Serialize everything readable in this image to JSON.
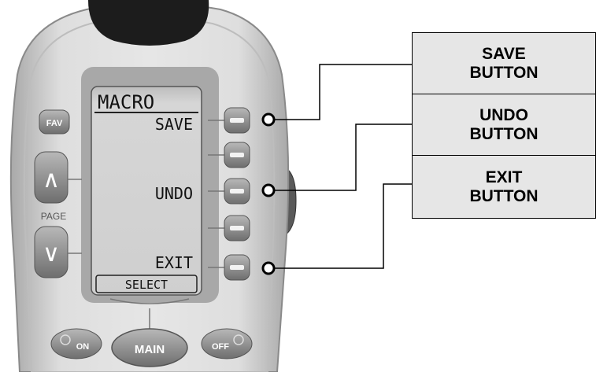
{
  "remote": {
    "screen": {
      "title": "MACRO",
      "soft_labels": [
        "SAVE",
        "UNDO",
        "EXIT"
      ],
      "bottom_label": "SELECT"
    },
    "buttons": {
      "fav": "FAV",
      "page": "PAGE",
      "page_up": "∧",
      "page_down": "∨",
      "on": "ON",
      "main": "MAIN",
      "off": "OFF"
    }
  },
  "callouts": [
    {
      "line1": "SAVE",
      "line2": "BUTTON"
    },
    {
      "line1": "UNDO",
      "line2": "BUTTON"
    },
    {
      "line1": "EXIT",
      "line2": "BUTTON"
    }
  ],
  "colors": {
    "body": "#d9d9d9",
    "body_edge": "#9a9a9a",
    "screen": "#d4d4d4",
    "button": "#8c8c8c",
    "top_cap": "#1a1a1a",
    "callout_bg": "#e6e6e6"
  }
}
